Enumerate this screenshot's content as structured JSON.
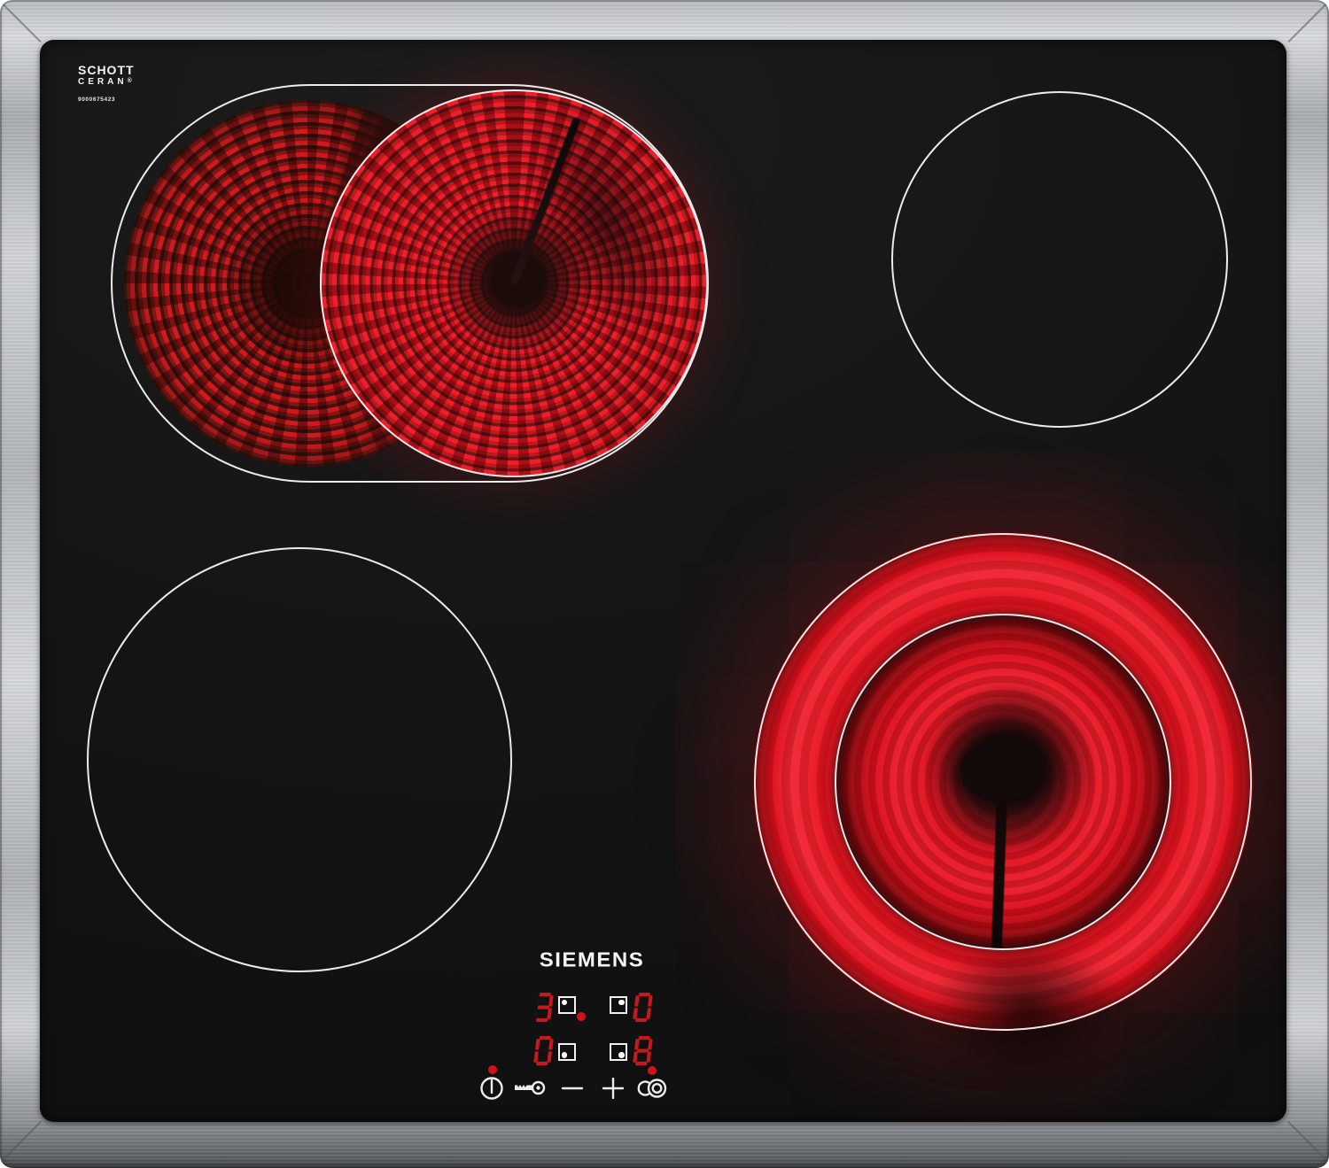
{
  "branding": {
    "glass_logo_line1": "SCHOTT",
    "glass_logo_line2": "CERAN",
    "glass_logo_mark": "®",
    "model_number": "9000675423",
    "manufacturer_logo": "SIEMENS"
  },
  "zone_displays": [
    {
      "zone": "back-left",
      "level": "3",
      "indicator_dot_corner": "top-left",
      "active_dot": true
    },
    {
      "zone": "back-right",
      "level": "0",
      "indicator_dot_corner": "top-right",
      "active_dot": false
    },
    {
      "zone": "front-left",
      "level": "0",
      "indicator_dot_corner": "bottom-left",
      "active_dot": false
    },
    {
      "zone": "front-right",
      "level": "8",
      "indicator_dot_corner": "bottom-right",
      "active_dot": true
    }
  ],
  "controls": {
    "power_indicator_dot": true,
    "buttons": [
      {
        "name": "power",
        "icon": "power-icon"
      },
      {
        "name": "child-lock",
        "icon": "key-icon"
      },
      {
        "name": "decrease",
        "icon": "minus-icon"
      },
      {
        "name": "increase",
        "icon": "plus-icon"
      },
      {
        "name": "dual-zone",
        "icon": "dual-zone-icon"
      }
    ]
  },
  "zones": [
    {
      "name": "back-left",
      "type": "dual-oval-extension",
      "state": "on"
    },
    {
      "name": "back-right",
      "type": "single-circle",
      "state": "off"
    },
    {
      "name": "front-left",
      "type": "single-circle",
      "state": "off"
    },
    {
      "name": "front-right",
      "type": "dual-ring",
      "state": "on"
    }
  ],
  "colors": {
    "frame_steel_light": "#d6d9dc",
    "frame_steel_dark": "#8f9398",
    "glass_black": "#151515",
    "heat_glow_red": "#ec1b28",
    "led_red": "#c8181e",
    "indicator_red": "#cf1318",
    "outline_white": "#f2f2f2"
  }
}
